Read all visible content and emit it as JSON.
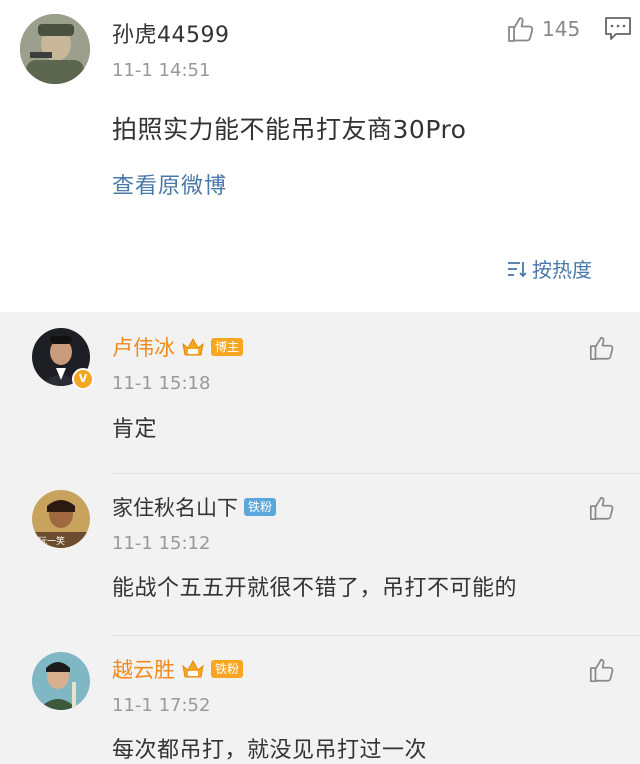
{
  "main_post": {
    "username": "孙虎44599",
    "time": "11-1 14:51",
    "like_count": "145",
    "text": "拍照实力能不能吊打友商30Pro",
    "view_original": "查看原微博",
    "sort_label": "按热度",
    "sort_icon": "sort-lines-icon",
    "like_icon": "thumbs-up-icon",
    "comment_icon": "comment-bubble-icon"
  },
  "replies": [
    {
      "username": "卢伟冰",
      "badge": "博主",
      "has_crown": true,
      "verified": true,
      "time": "11-1 15:18",
      "text": "肯定"
    },
    {
      "username": "家住秋名山下",
      "badge": "铁粉",
      "has_crown": false,
      "verified": false,
      "time": "11-1 15:12",
      "text": "能战个五五开就很不错了，吊打不可能的"
    },
    {
      "username": "越云胜",
      "badge": "铁粉",
      "has_crown": true,
      "verified": false,
      "time": "11-1 17:52",
      "text": "每次都吊打，就没见吊打过一次"
    }
  ],
  "colors": {
    "link": "#4a78a8",
    "vip_name": "#f08a1a",
    "badge_blue": "#5aa7dd",
    "badge_orange": "#f6a623",
    "reply_bg": "#f2f2f2"
  }
}
